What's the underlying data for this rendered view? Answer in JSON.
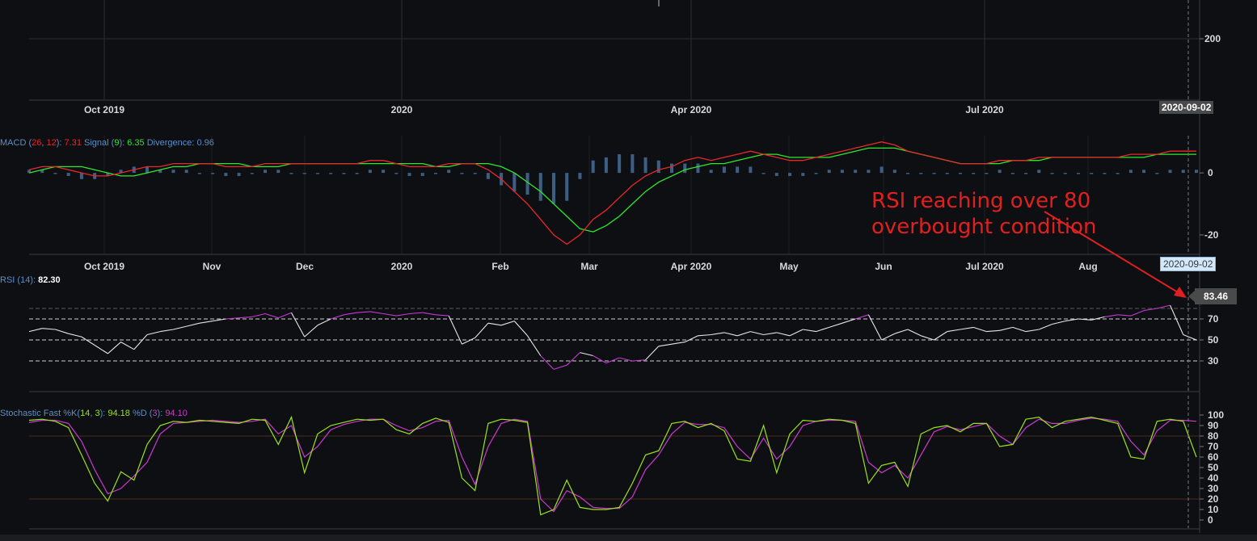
{
  "chart_data": [
    {
      "panel": "price",
      "type": "line",
      "y_ticks": [
        "200"
      ],
      "x_ticks": [
        "Oct 2019",
        "2020",
        "Apr 2020",
        "Jul 2020"
      ],
      "crosshair_date": "2020-09-02"
    },
    {
      "panel": "macd",
      "type": "line",
      "legend": {
        "name": "MACD",
        "fast": "26",
        "slow": "12",
        "macd_value": "7.31",
        "signal_label": "Signal",
        "signal_period": "9",
        "signal_value": "6.35",
        "divergence_label": "Divergence",
        "divergence_value": "0.96"
      },
      "y_ticks": [
        "0",
        "-20"
      ],
      "ylim": [
        -26,
        12
      ],
      "x_ticks": [
        "Oct 2019",
        "Nov",
        "Dec",
        "2020",
        "Feb",
        "Mar",
        "Apr 2020",
        "May",
        "Jun",
        "Jul 2020",
        "Aug"
      ],
      "crosshair_date": "2020-09-02",
      "series": [
        {
          "name": "MACD",
          "color": "#e8282b",
          "values": [
            1,
            2,
            2,
            1,
            0,
            -1,
            -1,
            0,
            1,
            2,
            2,
            3,
            3,
            3,
            3,
            2,
            2,
            2,
            3,
            3,
            3,
            3,
            3,
            3,
            3,
            3,
            4,
            4,
            3,
            2,
            2,
            2,
            3,
            3,
            3,
            1,
            -2,
            -6,
            -10,
            -15,
            -20,
            -23,
            -20,
            -15,
            -12,
            -8,
            -4,
            -1,
            1,
            2,
            4,
            5,
            4,
            5,
            6,
            7,
            6,
            5,
            4,
            4,
            5,
            6,
            7,
            8,
            9,
            10,
            9,
            7,
            6,
            5,
            4,
            3,
            3,
            3,
            4,
            4,
            4,
            5,
            5,
            5,
            5,
            5,
            5,
            5,
            6,
            6,
            6,
            7,
            7,
            7
          ]
        },
        {
          "name": "Signal",
          "color": "#2ee82e",
          "values": [
            0,
            1,
            2,
            2,
            2,
            1,
            0,
            -1,
            -1,
            0,
            1,
            2,
            2,
            3,
            3,
            3,
            3,
            2,
            2,
            2,
            3,
            3,
            3,
            3,
            3,
            3,
            3,
            3,
            3,
            3,
            3,
            2,
            2,
            3,
            3,
            3,
            2,
            0,
            -3,
            -6,
            -10,
            -14,
            -18,
            -19,
            -17,
            -14,
            -10,
            -6,
            -3,
            -1,
            1,
            2,
            3,
            3,
            4,
            5,
            6,
            6,
            5,
            5,
            5,
            5,
            6,
            7,
            8,
            8,
            8,
            7,
            6,
            5,
            4,
            3,
            3,
            3,
            3,
            4,
            4,
            4,
            5,
            5,
            5,
            5,
            5,
            5,
            5,
            5,
            6,
            6,
            6,
            6
          ]
        },
        {
          "name": "Divergence",
          "color": "#3d5f86",
          "values": [
            1,
            1,
            0,
            -1,
            -2,
            -2,
            -1,
            1,
            2,
            2,
            1,
            1,
            1,
            0,
            0,
            -1,
            -1,
            0,
            1,
            1,
            0,
            0,
            0,
            0,
            0,
            0,
            1,
            1,
            0,
            -1,
            -1,
            0,
            1,
            0,
            0,
            -2,
            -4,
            -6,
            -7,
            -9,
            -10,
            -9,
            -2,
            4,
            5,
            6,
            6,
            5,
            4,
            3,
            3,
            3,
            1,
            2,
            2,
            2,
            0,
            -1,
            -1,
            -1,
            0,
            1,
            1,
            1,
            1,
            2,
            1,
            0,
            0,
            0,
            0,
            0,
            0,
            0,
            1,
            0,
            0,
            1,
            0,
            0,
            0,
            0,
            0,
            0,
            1,
            1,
            0,
            1,
            1,
            1
          ]
        }
      ]
    },
    {
      "panel": "rsi",
      "type": "line",
      "legend": {
        "name": "RSI",
        "period": "14",
        "value": "82.30"
      },
      "y_ticks": [
        "70",
        "50",
        "30"
      ],
      "ylim": [
        0,
        100
      ],
      "levels": [
        80,
        70,
        50,
        30
      ],
      "current_value_label": "83.46",
      "color_normal": "#e6e6e6",
      "color_overbought": "#c637d6",
      "series": [
        {
          "name": "RSI",
          "values": [
            58,
            61,
            60,
            56,
            53,
            45,
            37,
            48,
            41,
            55,
            58,
            60,
            63,
            66,
            68,
            70,
            71,
            72,
            75,
            71,
            76,
            53,
            64,
            70,
            74,
            76,
            77,
            75,
            73,
            75,
            76,
            74,
            73,
            46,
            52,
            66,
            64,
            68,
            54,
            35,
            22,
            26,
            38,
            35,
            28,
            33,
            30,
            31,
            44,
            46,
            48,
            54,
            55,
            57,
            54,
            58,
            55,
            57,
            54,
            60,
            58,
            62,
            66,
            70,
            74,
            50,
            56,
            60,
            54,
            50,
            58,
            60,
            62,
            58,
            59,
            62,
            58,
            60,
            65,
            68,
            70,
            69,
            72,
            74,
            73,
            78,
            80,
            83,
            55,
            50
          ]
        }
      ],
      "annotation": {
        "lines": [
          "RSI reaching over 80",
          "overbought condition"
        ],
        "color": "#e02020"
      }
    },
    {
      "panel": "stochastic",
      "type": "line",
      "legend": {
        "name": "Stochastic Fast",
        "k_label": "%K",
        "k_period": "14",
        "k_smooth": "3",
        "k_value": "94.18",
        "d_label": "%D",
        "d_period": "3",
        "d_value": "94.10"
      },
      "y_ticks": [
        "100",
        "90",
        "80",
        "70",
        "60",
        "50",
        "40",
        "30",
        "20",
        "10",
        "0"
      ],
      "ylim": [
        -5,
        105
      ],
      "levels": [
        80,
        20
      ],
      "series": [
        {
          "name": "%K",
          "color": "#9be21c",
          "values": [
            95,
            96,
            94,
            88,
            62,
            35,
            18,
            46,
            38,
            72,
            90,
            94,
            93,
            95,
            94,
            93,
            92,
            96,
            95,
            72,
            98,
            45,
            82,
            90,
            93,
            96,
            95,
            96,
            86,
            82,
            92,
            97,
            93,
            40,
            28,
            92,
            96,
            95,
            93,
            5,
            10,
            38,
            12,
            10,
            10,
            12,
            35,
            62,
            66,
            92,
            94,
            88,
            92,
            85,
            58,
            56,
            90,
            45,
            82,
            95,
            94,
            96,
            95,
            92,
            35,
            52,
            55,
            32,
            82,
            88,
            90,
            84,
            92,
            92,
            70,
            72,
            96,
            98,
            88,
            94,
            96,
            98,
            95,
            92,
            60,
            58,
            94,
            96,
            94,
            60
          ]
        },
        {
          "name": "%D",
          "color": "#cc3ad1",
          "values": [
            93,
            95,
            95,
            92,
            75,
            48,
            25,
            30,
            42,
            55,
            82,
            92,
            93,
            94,
            95,
            94,
            93,
            94,
            96,
            82,
            90,
            60,
            70,
            86,
            91,
            94,
            96,
            96,
            90,
            85,
            88,
            94,
            95,
            60,
            34,
            70,
            92,
            96,
            94,
            20,
            8,
            28,
            22,
            12,
            11,
            11,
            22,
            48,
            62,
            82,
            93,
            91,
            91,
            88,
            70,
            58,
            78,
            58,
            70,
            90,
            94,
            95,
            95,
            94,
            55,
            45,
            52,
            40,
            62,
            84,
            89,
            86,
            89,
            92,
            80,
            72,
            88,
            96,
            92,
            92,
            95,
            97,
            96,
            94,
            75,
            62,
            85,
            95,
            95,
            94
          ]
        }
      ]
    }
  ]
}
